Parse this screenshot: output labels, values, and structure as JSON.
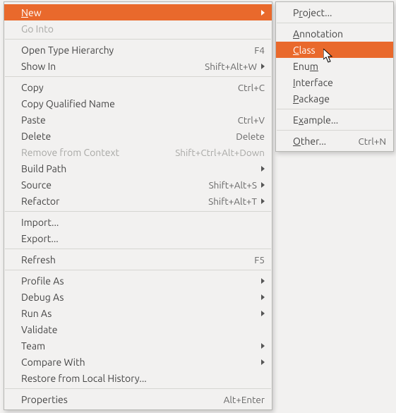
{
  "menu_left": {
    "new": {
      "label_pre": "",
      "mn": "N",
      "label_post": "ew"
    },
    "go_into": {
      "label": "Go Into"
    },
    "open_type_hierarchy": {
      "label": "Open Type Hierarchy",
      "accel": "F4"
    },
    "show_in": {
      "label": "Show In",
      "accel": "Shift+Alt+W"
    },
    "copy": {
      "label": "Copy",
      "accel": "Ctrl+C"
    },
    "copy_qualified_name": {
      "label": "Copy Qualified Name"
    },
    "paste": {
      "label": "Paste",
      "accel": "Ctrl+V"
    },
    "delete": {
      "label": "Delete",
      "accel": "Delete"
    },
    "remove_from_context": {
      "label": "Remove from Context",
      "accel": "Shift+Ctrl+Alt+Down"
    },
    "build_path": {
      "label": "Build Path"
    },
    "source": {
      "label": "Source",
      "accel": "Shift+Alt+S"
    },
    "refactor": {
      "label": "Refactor",
      "accel": "Shift+Alt+T"
    },
    "import": {
      "label": "Import..."
    },
    "export": {
      "label": "Export..."
    },
    "refresh": {
      "label": "Refresh",
      "accel": "F5"
    },
    "profile_as": {
      "label": "Profile As"
    },
    "debug_as": {
      "label": "Debug As"
    },
    "run_as": {
      "label": "Run As"
    },
    "validate": {
      "label": "Validate"
    },
    "team": {
      "label": "Team"
    },
    "compare_with": {
      "label": "Compare With"
    },
    "restore_from_local_history": {
      "label": "Restore from Local History..."
    },
    "properties": {
      "label": "Properties",
      "accel": "Alt+Enter"
    }
  },
  "menu_right": {
    "project": {
      "label_pre": "P",
      "mn": "r",
      "label_post": "oject..."
    },
    "annotation": {
      "label_pre": "",
      "mn": "A",
      "label_post": "nnotation"
    },
    "class": {
      "label_pre": "",
      "mn": "C",
      "label_post": "lass"
    },
    "enum": {
      "label_pre": "Enu",
      "mn": "m",
      "label_post": ""
    },
    "interface": {
      "label_pre": "",
      "mn": "I",
      "label_post": "nterface"
    },
    "package": {
      "label_pre": "",
      "mn": "P",
      "label_post": "ackage"
    },
    "example": {
      "label_pre": "E",
      "mn": "x",
      "label_post": "ample..."
    },
    "other": {
      "label_pre": "",
      "mn": "O",
      "label_post": "ther...",
      "accel": "Ctrl+N"
    }
  }
}
